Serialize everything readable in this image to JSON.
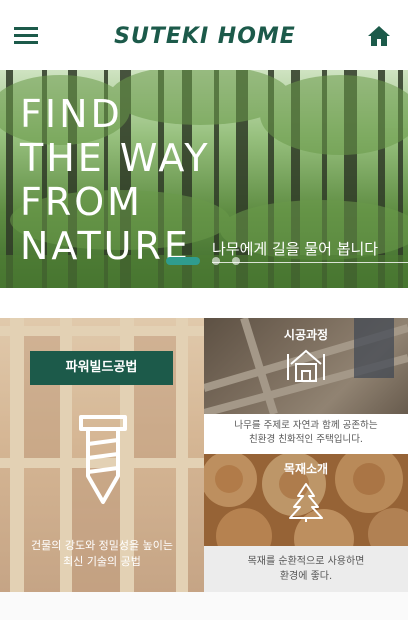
{
  "header": {
    "brand": "SUTEKI HOME",
    "menu_icon": "hamburger-menu-icon",
    "home_icon": "home-icon",
    "brand_color": "#1c5a4a"
  },
  "hero": {
    "headline": [
      "FIND",
      "THE WAY",
      "FROM",
      "NATURE"
    ],
    "subtitle": "나무에게 길을 물어 봅니다",
    "slides_total": 3,
    "active_slide": 1,
    "accent": "#2f9c8e"
  },
  "features": {
    "power_build": {
      "label": "파워빌드공법",
      "description_lines": [
        "건물의 강도와 정밀성을 높이는",
        "최신 기술의 공법"
      ],
      "icon": "screw-icon"
    },
    "construction": {
      "title": "시공과정",
      "description_lines": [
        "나무를 주제로 자연과 함께 공존하는",
        "친환경 친화적인 주택입니다."
      ],
      "icon": "house-outline-icon"
    },
    "wood": {
      "title": "목재소개",
      "description_lines": [
        "목재를 순환적으로 사용하면",
        "환경에 좋다."
      ],
      "icon": "tree-icon"
    }
  }
}
